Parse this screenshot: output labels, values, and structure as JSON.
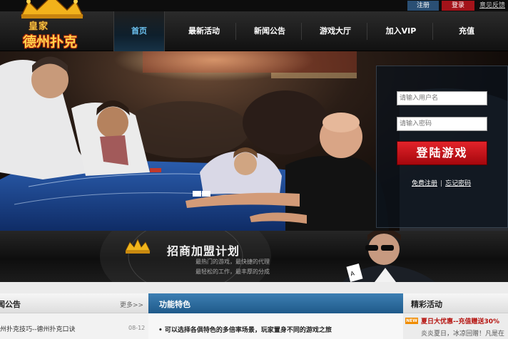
{
  "topbar": {
    "register": "注册",
    "login": "登录",
    "feedback": "意见反馈"
  },
  "logo": {
    "line1": "皇家",
    "line2": "德州扑克"
  },
  "nav": [
    "首页",
    "最新活动",
    "新闻公告",
    "游戏大厅",
    "加入VIP",
    "充值"
  ],
  "login_form": {
    "username_placeholder": "请输入用户名",
    "password_placeholder": "请输入密码",
    "submit": "登陆游戏",
    "register_link": "免费注册",
    "forgot_link": "忘记密码"
  },
  "banner": {
    "title": "招商加盟计划",
    "line1": "最热门的游戏，最快捷的代理",
    "line2": "最轻松的工作，最丰厚的分成"
  },
  "news": {
    "title": "闻公告",
    "more": "更多>>",
    "items": [
      {
        "text": "州扑克技巧--德州扑克口诀",
        "date": "08-12"
      },
      {
        "text": "",
        "date": ""
      }
    ]
  },
  "features": {
    "title": "功能特色",
    "item": "• 可以选择各俱特色的多倍率场景，玩家置身不同的游戏之旅"
  },
  "promo": {
    "title": "精彩活动",
    "badge": "NEW",
    "item_title": "夏日大优惠--充值赠送30%",
    "item_desc": "炎炎夏日，冰凉回赠！凡是在"
  },
  "colors": {
    "accent": "#6cc3f2",
    "login_red": "#d3171e",
    "features_blue": "#2e6d9e"
  }
}
